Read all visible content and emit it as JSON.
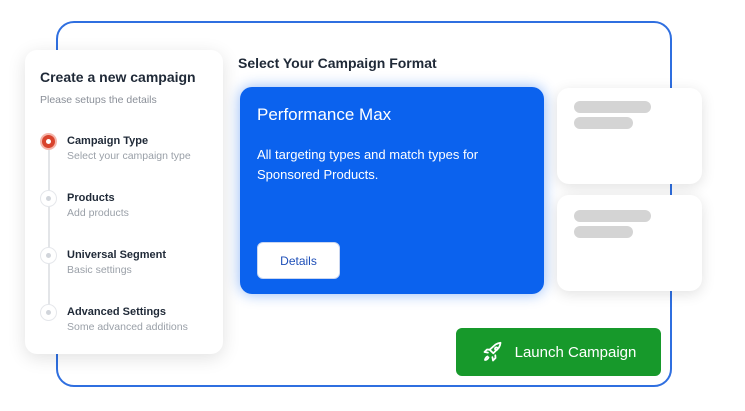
{
  "sidebar": {
    "title": "Create a new campaign",
    "subtitle": "Please setups the details",
    "steps": [
      {
        "label": "Campaign Type",
        "description": "Select your campaign type",
        "active": true
      },
      {
        "label": "Products",
        "description": "Add products",
        "active": false
      },
      {
        "label": "Universal Segment",
        "description": "Basic settings",
        "active": false
      },
      {
        "label": "Advanced Settings",
        "description": "Some advanced additions",
        "active": false
      }
    ]
  },
  "main": {
    "title": "Select Your Campaign Format",
    "selected_format": {
      "name": "Performance Max",
      "description": "All targeting types and match types for Sponsored Products.",
      "details_label": "Details"
    },
    "launch_label": "Launch Campaign",
    "launch_icon": "rocket-icon"
  },
  "colors": {
    "frame_border": "#2f6fe0",
    "selected_card": "#0b62ee",
    "launch_button": "#17992b",
    "active_step": "#d8432c"
  }
}
